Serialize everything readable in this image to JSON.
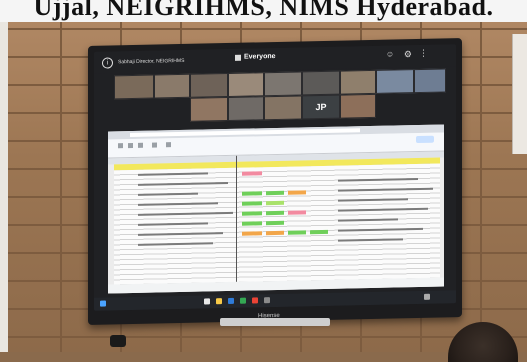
{
  "caption": {
    "text": "Ujjal, NEIGRIHMS, NIMS Hyderabad."
  },
  "meet": {
    "presenter_title": "Sabhaji Director, NEIGRIHMS",
    "audience_label": "Everyone",
    "self_tile_initials": "JP"
  },
  "tv": {
    "brand": "Hisense"
  },
  "colors": {
    "sheet_header_yellow": "#f2e85c",
    "status_green": "#6fcf5a",
    "status_orange": "#f2a64a",
    "status_pink": "#f28aa0",
    "add_button": "#e64553"
  },
  "icons": [
    "info-icon",
    "grid-icon",
    "people-icon",
    "settings-icon",
    "more-icon",
    "add-icon"
  ]
}
